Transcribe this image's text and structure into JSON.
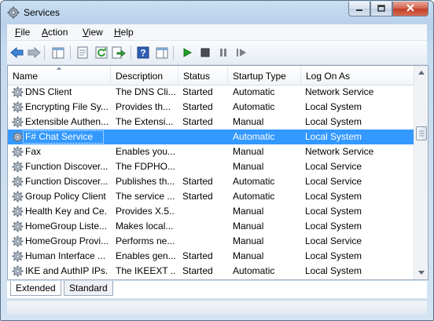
{
  "window": {
    "title": "Services",
    "icon": "gear-icon",
    "buttons": {
      "minimize": "minimize-icon",
      "maximize": "maximize-icon",
      "close": "close-icon"
    }
  },
  "menu": {
    "file": {
      "accel": "F",
      "rest": "ile"
    },
    "action": {
      "accel": "A",
      "rest": "ction"
    },
    "view": {
      "accel": "V",
      "rest": "iew"
    },
    "help": {
      "accel": "H",
      "rest": "elp"
    }
  },
  "toolbar": {
    "icons": [
      "back-arrow-icon",
      "forward-arrow-icon",
      "console-tree-icon",
      "properties-icon",
      "refresh-icon",
      "export-list-icon",
      "help-icon",
      "show-action-pane-icon",
      "play-icon",
      "stop-icon",
      "pause-icon",
      "restart-icon"
    ]
  },
  "table": {
    "headers": {
      "name": "Name",
      "description": "Description",
      "status": "Status",
      "startup": "Startup Type",
      "logon": "Log On As"
    },
    "rows": [
      {
        "name": "DNS Client",
        "description": "The DNS Cli...",
        "status": "Started",
        "startup": "Automatic",
        "logon": "Network Service"
      },
      {
        "name": "Encrypting File Sy...",
        "description": "Provides th...",
        "status": "Started",
        "startup": "Automatic",
        "logon": "Local System"
      },
      {
        "name": "Extensible Authen...",
        "description": "The Extensi...",
        "status": "Started",
        "startup": "Manual",
        "logon": "Local System"
      },
      {
        "name": "F# Chat Service",
        "description": "",
        "status": "",
        "startup": "Automatic",
        "logon": "Local System"
      },
      {
        "name": "Fax",
        "description": "Enables you...",
        "status": "",
        "startup": "Manual",
        "logon": "Network Service"
      },
      {
        "name": "Function Discover...",
        "description": "The FDPHO...",
        "status": "",
        "startup": "Manual",
        "logon": "Local Service"
      },
      {
        "name": "Function Discover...",
        "description": "Publishes th...",
        "status": "Started",
        "startup": "Automatic",
        "logon": "Local Service"
      },
      {
        "name": "Group Policy Client",
        "description": "The service ...",
        "status": "Started",
        "startup": "Automatic",
        "logon": "Local System"
      },
      {
        "name": "Health Key and Ce...",
        "description": "Provides X.5...",
        "status": "",
        "startup": "Manual",
        "logon": "Local System"
      },
      {
        "name": "HomeGroup Liste...",
        "description": "Makes local...",
        "status": "",
        "startup": "Manual",
        "logon": "Local System"
      },
      {
        "name": "HomeGroup Provi...",
        "description": "Performs ne...",
        "status": "",
        "startup": "Manual",
        "logon": "Local Service"
      },
      {
        "name": "Human Interface ...",
        "description": "Enables gen...",
        "status": "Started",
        "startup": "Manual",
        "logon": "Local System"
      },
      {
        "name": "IKE and AuthIP IPs...",
        "description": "The IKEEXT ...",
        "status": "Started",
        "startup": "Automatic",
        "logon": "Local System"
      }
    ],
    "selected_index": 3
  },
  "tabs": {
    "extended": "Extended",
    "standard": "Standard"
  },
  "colors": {
    "selection": "#3399ff",
    "play": "#22a02a"
  }
}
